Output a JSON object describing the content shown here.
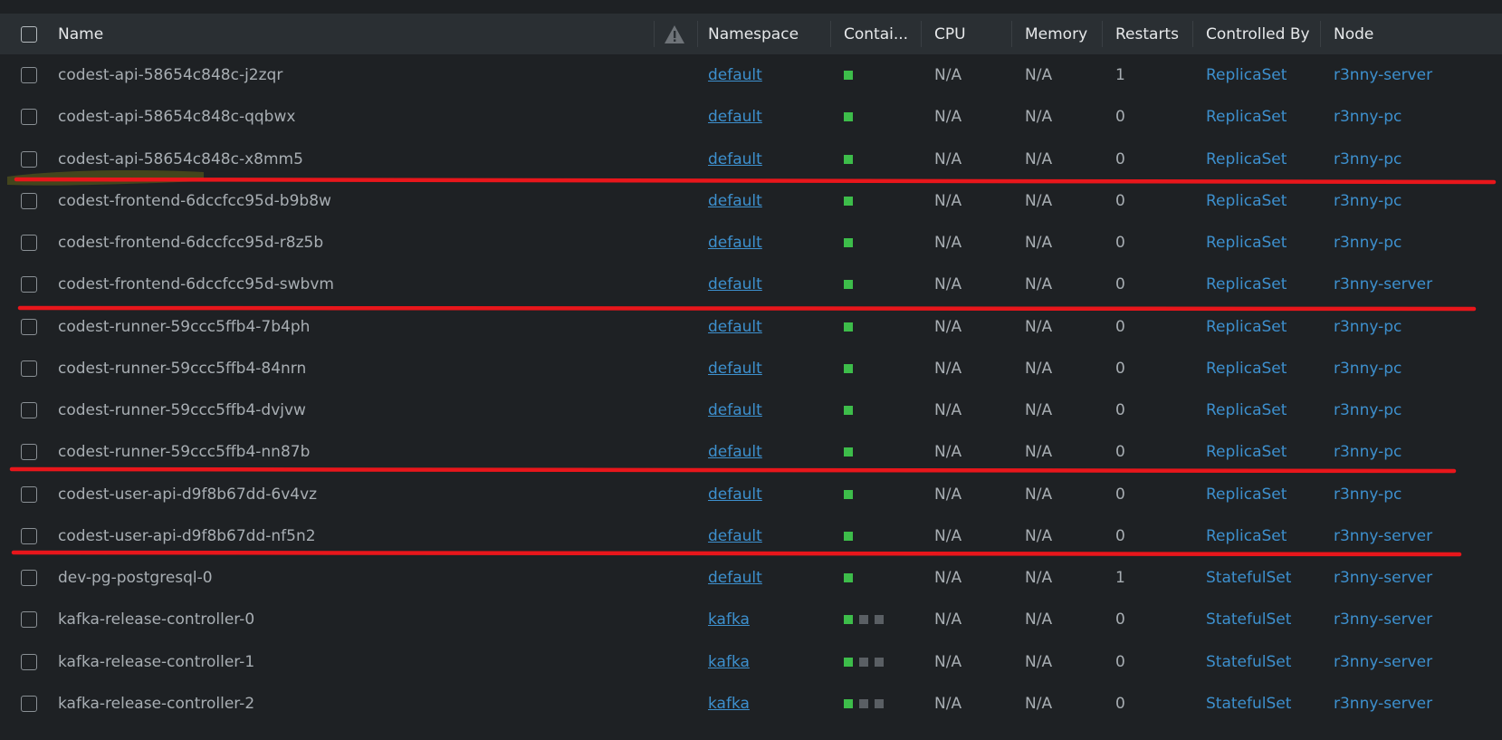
{
  "header": {
    "name": "Name",
    "namespace": "Namespace",
    "containers": "Contai...",
    "cpu": "CPU",
    "memory": "Memory",
    "restarts": "Restarts",
    "controlled_by": "Controlled By",
    "node": "Node"
  },
  "colors": {
    "background": "#1e2124",
    "header_bg": "#2a2f33",
    "link": "#3d90ce",
    "container_ok": "#3dbd4a",
    "container_pending": "#5a5f64",
    "annotation_line": "#e8161b",
    "highlight": "#c8c800"
  },
  "rows": [
    {
      "name": "codest-api-58654c848c-j2zqr",
      "namespace": "default",
      "containers": [
        "ok"
      ],
      "cpu": "N/A",
      "memory": "N/A",
      "restarts": "1",
      "controlled_by": "ReplicaSet",
      "node": "r3nny-server"
    },
    {
      "name": "codest-api-58654c848c-qqbwx",
      "namespace": "default",
      "containers": [
        "ok"
      ],
      "cpu": "N/A",
      "memory": "N/A",
      "restarts": "0",
      "controlled_by": "ReplicaSet",
      "node": "r3nny-pc"
    },
    {
      "name": "codest-api-58654c848c-x8mm5",
      "namespace": "default",
      "containers": [
        "ok"
      ],
      "cpu": "N/A",
      "memory": "N/A",
      "restarts": "0",
      "controlled_by": "ReplicaSet",
      "node": "r3nny-pc"
    },
    {
      "name": "codest-frontend-6dccfcc95d-b9b8w",
      "namespace": "default",
      "containers": [
        "ok"
      ],
      "cpu": "N/A",
      "memory": "N/A",
      "restarts": "0",
      "controlled_by": "ReplicaSet",
      "node": "r3nny-pc"
    },
    {
      "name": "codest-frontend-6dccfcc95d-r8z5b",
      "namespace": "default",
      "containers": [
        "ok"
      ],
      "cpu": "N/A",
      "memory": "N/A",
      "restarts": "0",
      "controlled_by": "ReplicaSet",
      "node": "r3nny-pc"
    },
    {
      "name": "codest-frontend-6dccfcc95d-swbvm",
      "namespace": "default",
      "containers": [
        "ok"
      ],
      "cpu": "N/A",
      "memory": "N/A",
      "restarts": "0",
      "controlled_by": "ReplicaSet",
      "node": "r3nny-server"
    },
    {
      "name": "codest-runner-59ccc5ffb4-7b4ph",
      "namespace": "default",
      "containers": [
        "ok"
      ],
      "cpu": "N/A",
      "memory": "N/A",
      "restarts": "0",
      "controlled_by": "ReplicaSet",
      "node": "r3nny-pc"
    },
    {
      "name": "codest-runner-59ccc5ffb4-84nrn",
      "namespace": "default",
      "containers": [
        "ok"
      ],
      "cpu": "N/A",
      "memory": "N/A",
      "restarts": "0",
      "controlled_by": "ReplicaSet",
      "node": "r3nny-pc"
    },
    {
      "name": "codest-runner-59ccc5ffb4-dvjvw",
      "namespace": "default",
      "containers": [
        "ok"
      ],
      "cpu": "N/A",
      "memory": "N/A",
      "restarts": "0",
      "controlled_by": "ReplicaSet",
      "node": "r3nny-pc"
    },
    {
      "name": "codest-runner-59ccc5ffb4-nn87b",
      "namespace": "default",
      "containers": [
        "ok"
      ],
      "cpu": "N/A",
      "memory": "N/A",
      "restarts": "0",
      "controlled_by": "ReplicaSet",
      "node": "r3nny-pc"
    },
    {
      "name": "codest-user-api-d9f8b67dd-6v4vz",
      "namespace": "default",
      "containers": [
        "ok"
      ],
      "cpu": "N/A",
      "memory": "N/A",
      "restarts": "0",
      "controlled_by": "ReplicaSet",
      "node": "r3nny-pc"
    },
    {
      "name": "codest-user-api-d9f8b67dd-nf5n2",
      "namespace": "default",
      "containers": [
        "ok"
      ],
      "cpu": "N/A",
      "memory": "N/A",
      "restarts": "0",
      "controlled_by": "ReplicaSet",
      "node": "r3nny-server"
    },
    {
      "name": "dev-pg-postgresql-0",
      "namespace": "default",
      "containers": [
        "ok"
      ],
      "cpu": "N/A",
      "memory": "N/A",
      "restarts": "1",
      "controlled_by": "StatefulSet",
      "node": "r3nny-server"
    },
    {
      "name": "kafka-release-controller-0",
      "namespace": "kafka",
      "containers": [
        "ok",
        "pending",
        "pending"
      ],
      "cpu": "N/A",
      "memory": "N/A",
      "restarts": "0",
      "controlled_by": "StatefulSet",
      "node": "r3nny-server"
    },
    {
      "name": "kafka-release-controller-1",
      "namespace": "kafka",
      "containers": [
        "ok",
        "pending",
        "pending"
      ],
      "cpu": "N/A",
      "memory": "N/A",
      "restarts": "0",
      "controlled_by": "StatefulSet",
      "node": "r3nny-server"
    },
    {
      "name": "kafka-release-controller-2",
      "namespace": "kafka",
      "containers": [
        "ok",
        "pending",
        "pending"
      ],
      "cpu": "N/A",
      "memory": "N/A",
      "restarts": "0",
      "controlled_by": "StatefulSet",
      "node": "r3nny-server"
    }
  ]
}
